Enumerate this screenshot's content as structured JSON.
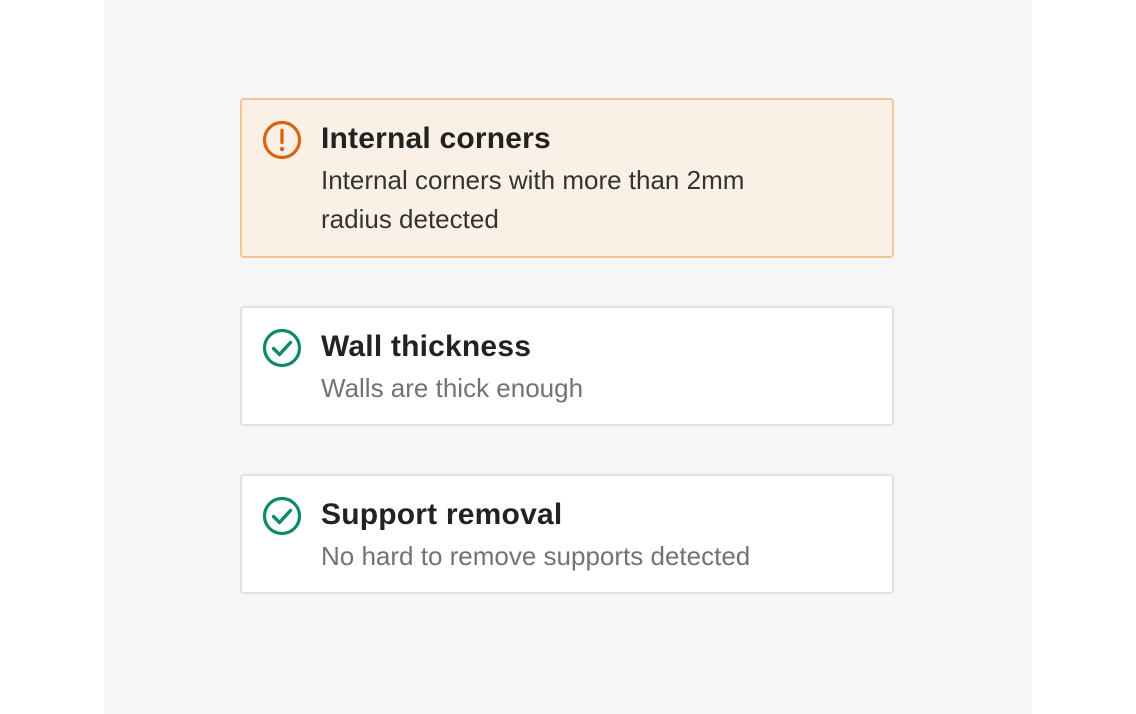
{
  "checks": [
    {
      "status": "warning",
      "icon": "exclamation-circle-icon",
      "title": "Internal corners",
      "description": "Internal corners with more than 2mm radius detected"
    },
    {
      "status": "pass",
      "icon": "check-circle-icon",
      "title": "Wall thickness",
      "description": "Walls are thick enough"
    },
    {
      "status": "pass",
      "icon": "check-circle-icon",
      "title": "Support removal",
      "description": "No hard to remove supports detected"
    }
  ],
  "colors": {
    "panel_bg": "#f6f6f6",
    "warning_bg": "#fbf0e5",
    "warning_border": "#f3c495",
    "warning_icon": "#d9650f",
    "pass_icon": "#0e8a6a",
    "pass_border": "#e2e2e2"
  }
}
